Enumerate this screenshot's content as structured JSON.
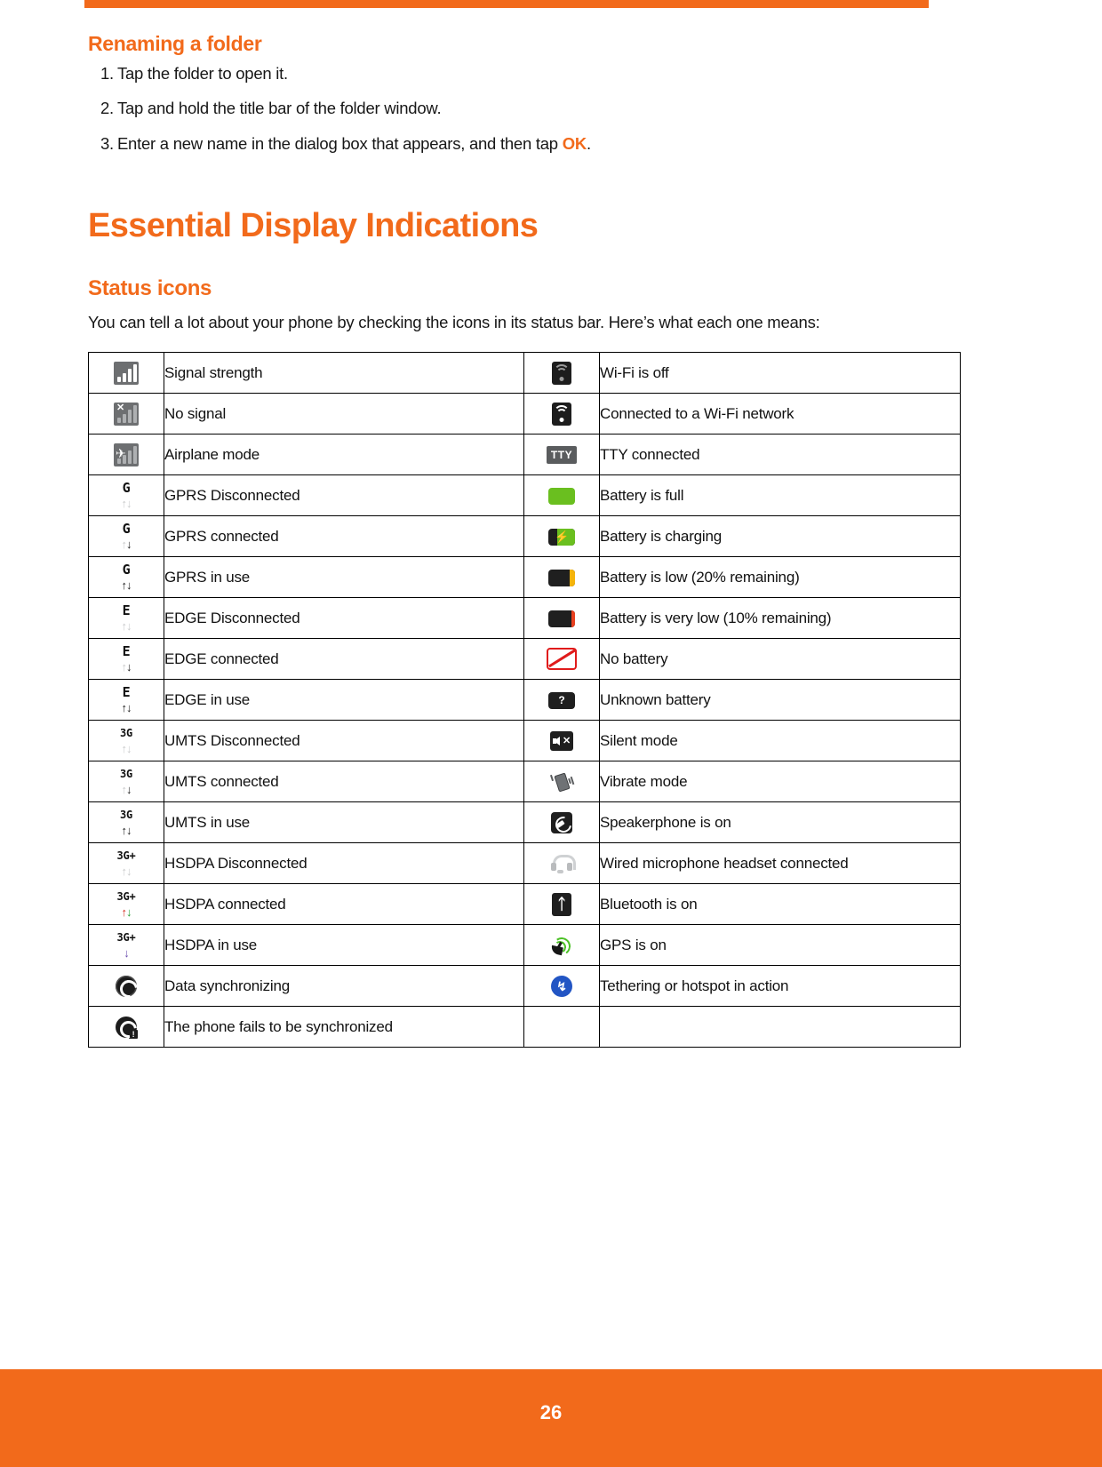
{
  "theme": {
    "accent": "#f26a1b",
    "text": "#171717"
  },
  "top_rule": {
    "name": "top-orange-rule"
  },
  "renaming": {
    "heading": "Renaming a folder",
    "steps": [
      {
        "num": "1.",
        "text": "Tap the folder to open it."
      },
      {
        "num": "2.",
        "text": "Tap and hold the title bar of the folder window."
      },
      {
        "num": "3.",
        "text": "Enter a new name in the dialog box that appears, and then tap ",
        "emphasis": "OK",
        "tail": "."
      }
    ]
  },
  "section": {
    "title": "Essential Display Indications",
    "subtitle": "Status icons",
    "intro": "You can tell a lot about your phone by checking the icons in its status bar. Here’s what each one means:"
  },
  "table": {
    "left_rows": [
      {
        "icon": "signal-strength-icon",
        "label": "Signal strength"
      },
      {
        "icon": "no-signal-icon",
        "label": "No signal"
      },
      {
        "icon": "airplane-mode-icon",
        "label": "Airplane mode"
      },
      {
        "icon": "gprs-disconnected-icon",
        "label": "GPRS Disconnected"
      },
      {
        "icon": "gprs-connected-icon",
        "label": "GPRS connected"
      },
      {
        "icon": "gprs-in-use-icon",
        "label": "GPRS in use"
      },
      {
        "icon": "edge-disconnected-icon",
        "label": "EDGE Disconnected"
      },
      {
        "icon": "edge-connected-icon",
        "label": "EDGE connected"
      },
      {
        "icon": "edge-in-use-icon",
        "label": "EDGE in use"
      },
      {
        "icon": "umts-disconnected-icon",
        "label": "UMTS Disconnected"
      },
      {
        "icon": "umts-connected-icon",
        "label": "UMTS connected"
      },
      {
        "icon": "umts-in-use-icon",
        "label": "UMTS in use"
      },
      {
        "icon": "hsdpa-disconnected-icon",
        "label": "HSDPA Disconnected"
      },
      {
        "icon": "hsdpa-connected-icon",
        "label": "HSDPA connected"
      },
      {
        "icon": "hsdpa-in-use-icon",
        "label": "HSDPA in use"
      },
      {
        "icon": "data-synchronizing-icon",
        "label": "Data synchronizing"
      },
      {
        "icon": "sync-failed-icon",
        "label": "The phone fails to be synchronized"
      }
    ],
    "right_rows": [
      {
        "icon": "wifi-off-icon",
        "label": "Wi-Fi is off"
      },
      {
        "icon": "wifi-connected-icon",
        "label": "Connected to a Wi-Fi network"
      },
      {
        "icon": "tty-icon",
        "label": "TTY connected"
      },
      {
        "icon": "battery-full-icon",
        "label": "Battery is full"
      },
      {
        "icon": "battery-charging-icon",
        "label": "Battery is charging"
      },
      {
        "icon": "battery-low-icon",
        "label": "Battery is low (20% remaining)"
      },
      {
        "icon": "battery-very-low-icon",
        "label": "Battery is very low (10% remaining)"
      },
      {
        "icon": "no-battery-icon",
        "label": "No battery"
      },
      {
        "icon": "unknown-battery-icon",
        "label": "Unknown battery"
      },
      {
        "icon": "silent-mode-icon",
        "label": "Silent mode"
      },
      {
        "icon": "vibrate-mode-icon",
        "label": "Vibrate mode"
      },
      {
        "icon": "speakerphone-icon",
        "label": "Speakerphone is on"
      },
      {
        "icon": "wired-headset-icon",
        "label": "Wired microphone headset connected"
      },
      {
        "icon": "bluetooth-icon",
        "label": "Bluetooth is on"
      },
      {
        "icon": "gps-icon",
        "label": "GPS is on"
      },
      {
        "icon": "tethering-icon",
        "label": "Tethering or hotspot in action"
      }
    ]
  },
  "footer": {
    "page_number": "26"
  }
}
